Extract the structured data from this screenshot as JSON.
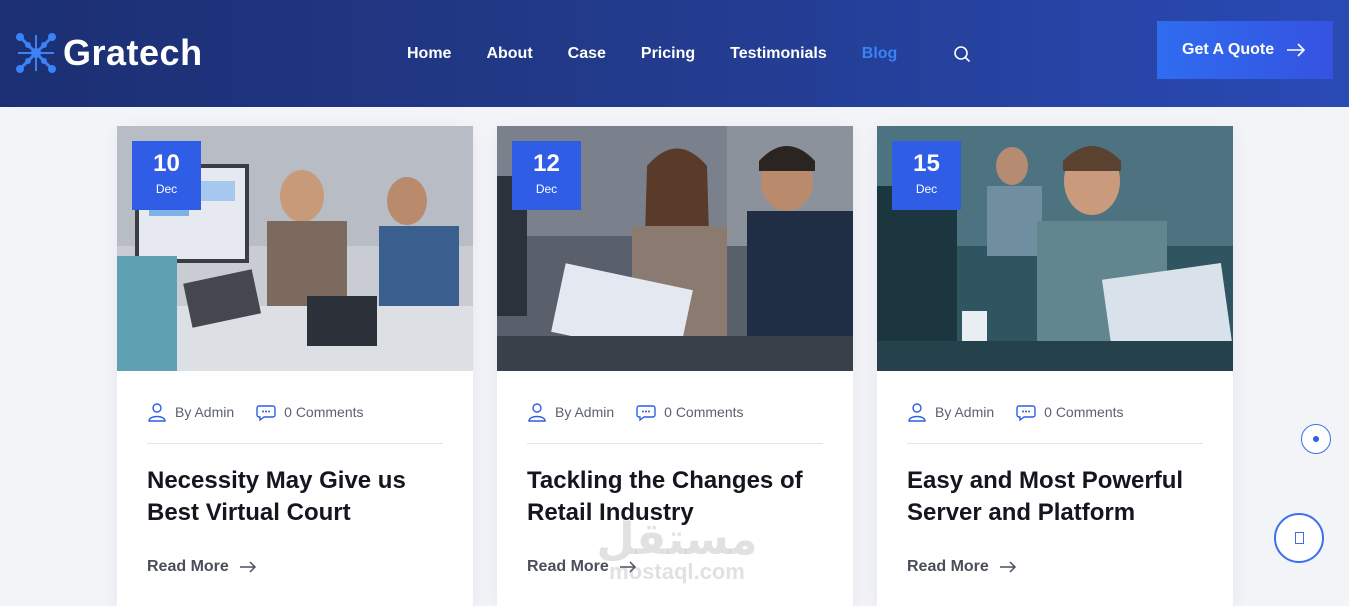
{
  "brand": {
    "name": "Gratech",
    "icon": "x-molecule-logo-icon"
  },
  "nav": {
    "items": [
      "Home",
      "About",
      "Case",
      "Pricing",
      "Testimonials",
      "Blog"
    ],
    "active": "Blog",
    "search_icon": "search-icon"
  },
  "header": {
    "cta_label": "Get A Quote",
    "cta_icon": "arrow-right-icon"
  },
  "colors": {
    "header_start": "#1c2f73",
    "header_end": "#2a4ab5",
    "accent": "#2f5de6",
    "active_nav": "#3b82f6",
    "title_text": "#14161f"
  },
  "posts": [
    {
      "day": "10",
      "month": "Dec",
      "author": "By Admin",
      "comments": "0 Comments",
      "title": "Necessity May Give us Best Virtual Court",
      "read_more": "Read More"
    },
    {
      "day": "12",
      "month": "Dec",
      "author": "By Admin",
      "comments": "0 Comments",
      "title": "Tackling the Changes of Retail Industry",
      "read_more": "Read More"
    },
    {
      "day": "15",
      "month": "Dec",
      "author": "By Admin",
      "comments": "0 Comments",
      "title": "Easy and Most Powerful Server and Platform",
      "read_more": "Read More"
    }
  ],
  "watermark": {
    "arabic": "مستقل",
    "latin": "mostaql.com"
  }
}
